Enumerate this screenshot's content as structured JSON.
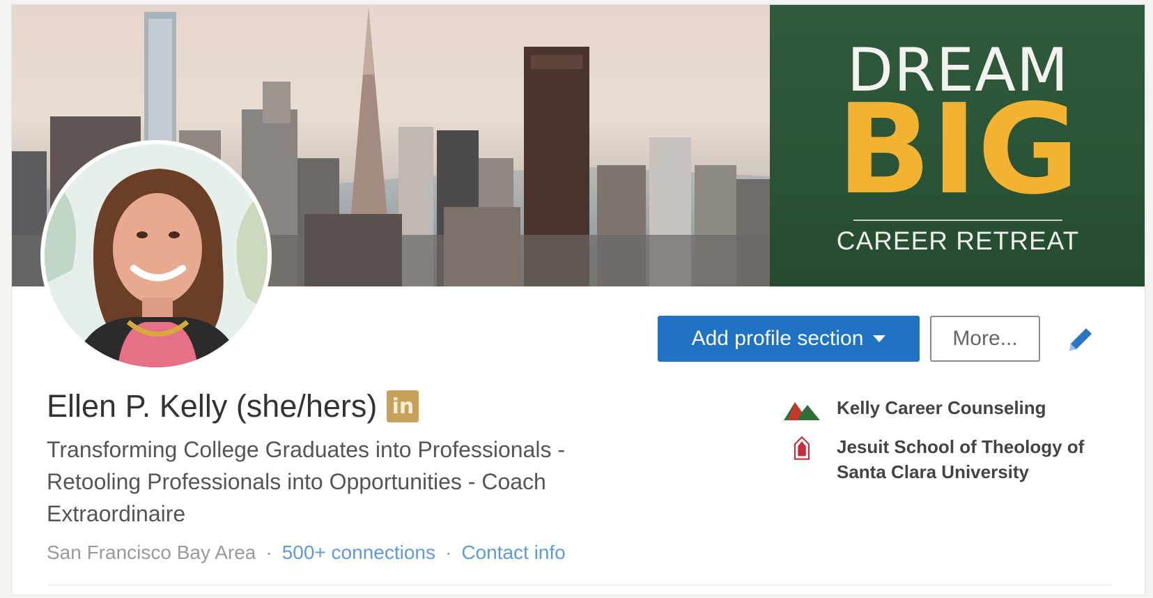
{
  "banner": {
    "promo_line1": "DREAM",
    "promo_line2": "BIG",
    "promo_line3": "CAREER RETREAT",
    "promo_bg": "#2b5436",
    "promo_accent": "#f1b331"
  },
  "actions": {
    "add_section_label": "Add profile section",
    "more_label": "More...",
    "edit_icon": "pencil-icon",
    "primary_color": "#1f73c2"
  },
  "profile": {
    "name": "Ellen P. Kelly (she/hers)",
    "badge": "in",
    "headline": "Transforming College Graduates into Professionals - Retooling Professionals into Opportunities - Coach Extraordinaire",
    "location": "San Francisco Bay Area",
    "separator": "·",
    "connections": "500+ connections",
    "contact": "Contact info"
  },
  "experience": [
    {
      "label": "Kelly Career Counseling",
      "icon": "company-logo-icon"
    },
    {
      "label": "Jesuit School of Theology of Santa Clara University",
      "icon": "school-logo-icon"
    }
  ]
}
